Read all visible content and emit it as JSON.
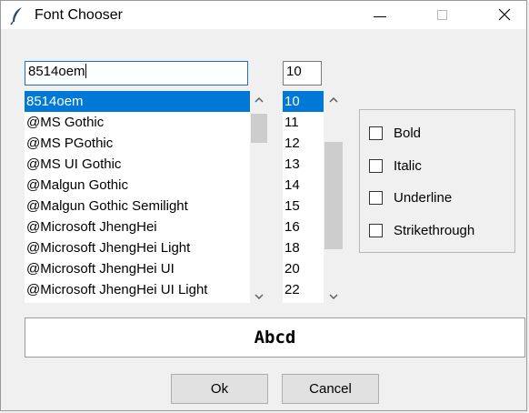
{
  "window": {
    "title": "Font Chooser",
    "icon": "feather-icon",
    "controls": [
      "minimize-icon",
      "maximize-icon",
      "close-icon"
    ]
  },
  "font_entry": {
    "value": "8514oem"
  },
  "size_entry": {
    "value": "10"
  },
  "font_list": {
    "selected": "8514oem",
    "items": [
      "8514oem",
      "@MS Gothic",
      "@MS PGothic",
      "@MS UI Gothic",
      "@Malgun Gothic",
      "@Malgun Gothic Semilight",
      "@Microsoft JhengHei",
      "@Microsoft JhengHei Light",
      "@Microsoft JhengHei UI",
      "@Microsoft JhengHei UI Light"
    ]
  },
  "size_list": {
    "selected": "10",
    "items": [
      "10",
      "11",
      "12",
      "13",
      "14",
      "15",
      "16",
      "18",
      "20",
      "22"
    ]
  },
  "styles": {
    "bold": "Bold",
    "italic": "Italic",
    "underline": "Underline",
    "strikethrough": "Strikethrough"
  },
  "preview": {
    "text": "Abcd"
  },
  "buttons": {
    "ok": "Ok",
    "cancel": "Cancel"
  },
  "colors": {
    "selection": "#0078d7",
    "focus_border": "#1b6fd0",
    "background": "#f0f0f0"
  }
}
